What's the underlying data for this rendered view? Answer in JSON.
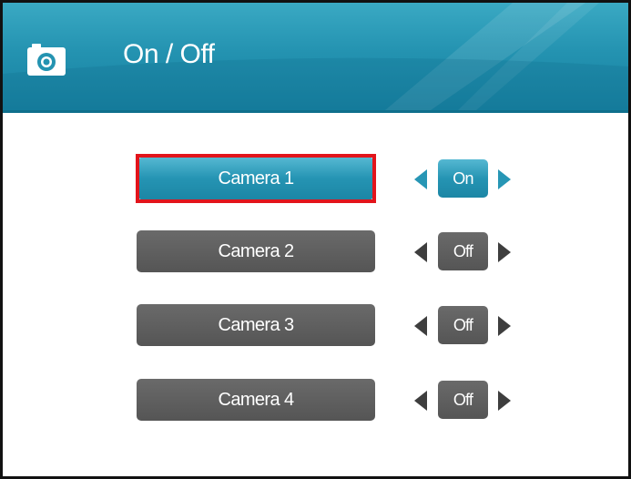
{
  "header": {
    "title": "On / Off",
    "icon": "camera-icon",
    "color": "#2493b1"
  },
  "cameras": [
    {
      "label": "Camera 1",
      "state": "On",
      "selected": true
    },
    {
      "label": "Camera 2",
      "state": "Off",
      "selected": false
    },
    {
      "label": "Camera 3",
      "state": "Off",
      "selected": false
    },
    {
      "label": "Camera 4",
      "state": "Off",
      "selected": false
    }
  ],
  "colors": {
    "accent": "#2594b3",
    "inactive": "#5f5f5f",
    "selection_outline": "#e2141b"
  }
}
